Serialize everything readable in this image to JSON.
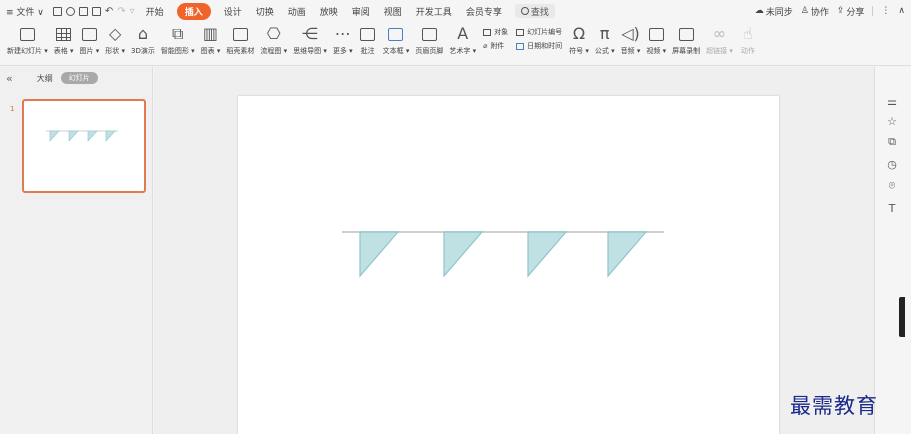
{
  "menubar": {
    "menu_label": "≡ 文件 ∨",
    "tabs": [
      "开始",
      "插入",
      "设计",
      "切换",
      "动画",
      "放映",
      "审阅",
      "视图",
      "开发工具",
      "会员专享"
    ],
    "active_tab": "插入",
    "search_label": "查找",
    "right": {
      "sync": "未同步",
      "collab": "协作",
      "share": "分享"
    }
  },
  "ribbon": {
    "buttons": [
      {
        "label": "新建幻灯片 ▾",
        "icon": "new-slide-icon"
      },
      {
        "label": "表格 ▾",
        "icon": "table-icon"
      },
      {
        "label": "图片 ▾",
        "icon": "picture-icon"
      },
      {
        "label": "形状 ▾",
        "icon": "shape-icon"
      },
      {
        "label": "3D演示",
        "icon": "3d-icon"
      },
      {
        "label": "智能图形 ▾",
        "icon": "smart-art-icon"
      },
      {
        "label": "图表 ▾",
        "icon": "chart-icon"
      },
      {
        "label": "稻壳素材",
        "icon": "material-icon"
      },
      {
        "label": "流程图 ▾",
        "icon": "flowchart-icon"
      },
      {
        "label": "思维导图 ▾",
        "icon": "mindmap-icon"
      },
      {
        "label": "更多 ▾",
        "icon": "more-icon"
      },
      {
        "label": "批注",
        "icon": "comment-icon"
      },
      {
        "label": "文本框 ▾",
        "icon": "textbox-icon"
      },
      {
        "label": "页眉页脚",
        "icon": "header-footer-icon"
      },
      {
        "label": "艺术字 ▾",
        "icon": "wordart-icon"
      }
    ],
    "small_group": {
      "object": "对象",
      "slide_number": "幻灯片编号",
      "attachment": "附件",
      "datetime": "日期和时间"
    },
    "buttons2": [
      {
        "label": "符号 ▾",
        "icon": "omega-icon"
      },
      {
        "label": "公式 ▾",
        "icon": "pi-icon"
      },
      {
        "label": "音频 ▾",
        "icon": "audio-icon"
      },
      {
        "label": "视频 ▾",
        "icon": "video-icon"
      },
      {
        "label": "屏幕录制",
        "icon": "screen-record-icon"
      },
      {
        "label": "超链接 ▾",
        "icon": "hyperlink-icon"
      },
      {
        "label": "动作",
        "icon": "action-icon"
      }
    ]
  },
  "leftpanel": {
    "outline_label": "大纲",
    "slides_label": "幻灯片",
    "slide_number": "1"
  },
  "slide": {
    "line_color": "#cfcfcf",
    "flag_color": "#bfe1e4",
    "flag_stroke": "#8fc5cb",
    "flag_count": 4
  },
  "watermark": "最需教育"
}
